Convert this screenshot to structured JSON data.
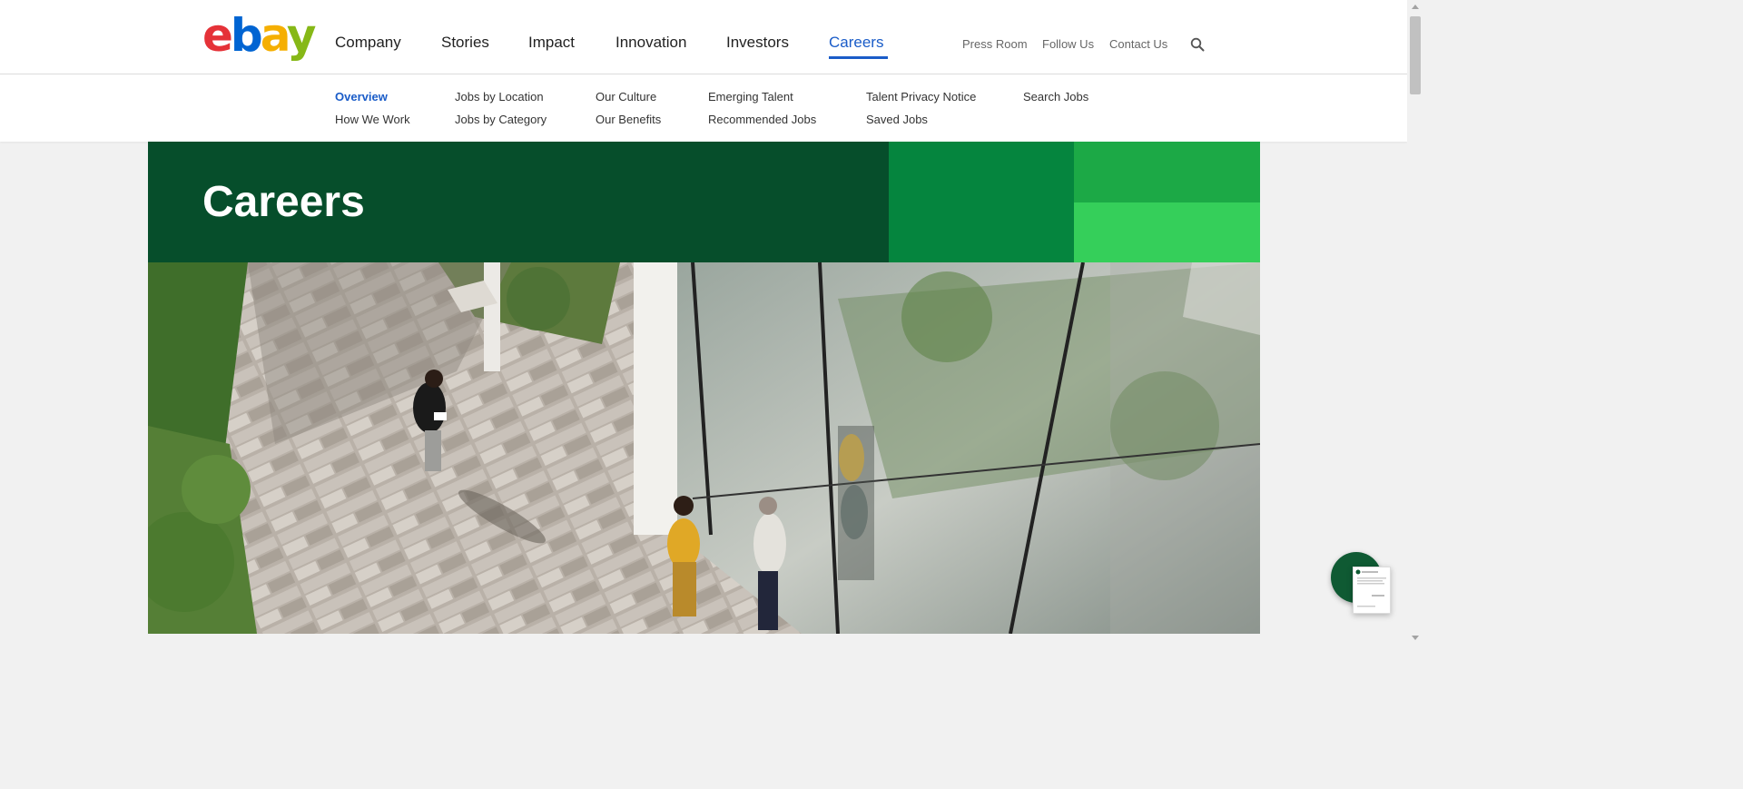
{
  "header": {
    "logo_letters": [
      "e",
      "b",
      "a",
      "y"
    ],
    "main_nav": [
      "Company",
      "Stories",
      "Impact",
      "Innovation",
      "Investors",
      "Careers"
    ],
    "active_main": "Careers",
    "utility_nav": [
      "Press Room",
      "Follow Us",
      "Contact Us"
    ],
    "search_icon": "search-icon"
  },
  "subnav": {
    "col1": [
      "Overview",
      "How We Work"
    ],
    "col2": [
      "Jobs by Location",
      "Jobs by Category"
    ],
    "col3": [
      "Our Culture",
      "Our Benefits"
    ],
    "col4": [
      "Emerging Talent",
      "Recommended Jobs"
    ],
    "col5": [
      "Talent Privacy Notice",
      "Saved Jobs"
    ],
    "col6": [
      "Search Jobs"
    ],
    "active": "Overview"
  },
  "hero": {
    "title": "Careers"
  },
  "colors": {
    "brand_blue": "#1a5cc8",
    "dark_green": "#064e2b",
    "mid_green": "#05853e",
    "green": "#1ca946",
    "light_green": "#35cf5a"
  }
}
